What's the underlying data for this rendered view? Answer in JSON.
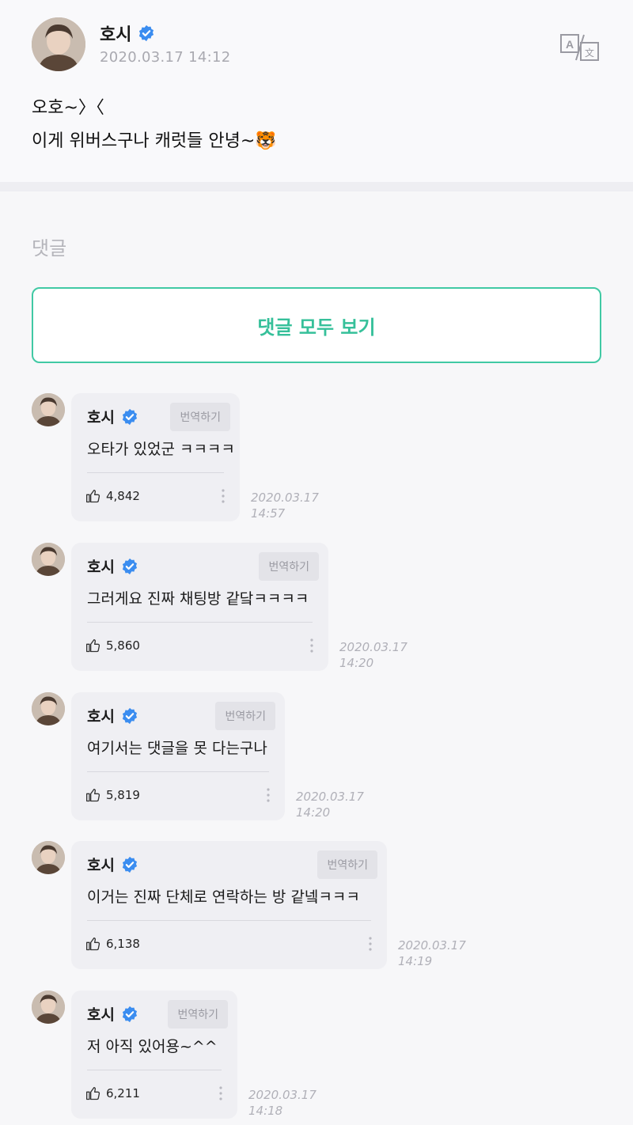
{
  "post": {
    "author": "호시",
    "timestamp": "2020.03.17 14:12",
    "lines": [
      "오호~〉〈",
      "이게 위버스구나 캐럿들 안녕~🐯"
    ],
    "translate_icon": "translate-icon"
  },
  "comments_section": {
    "label": "댓글",
    "view_all_label": "댓글 모두 보기"
  },
  "comments": [
    {
      "author": "호시",
      "translate_label": "번역하기",
      "text": "오타가 있었군 ㅋㅋㅋㅋ",
      "likes": "4,842",
      "date": "2020.03.17",
      "time": "14:57"
    },
    {
      "author": "호시",
      "translate_label": "번역하기",
      "text": "그러게요 진짜 채팅방 같닼ㅋㅋㅋㅋ",
      "likes": "5,860",
      "date": "2020.03.17",
      "time": "14:20"
    },
    {
      "author": "호시",
      "translate_label": "번역하기",
      "text": "여기서는 댓글을 못 다는구나",
      "likes": "5,819",
      "date": "2020.03.17",
      "time": "14:20"
    },
    {
      "author": "호시",
      "translate_label": "번역하기",
      "text": "이거는 진짜 단체로 연락하는 방 같넼ㅋㅋㅋ",
      "likes": "6,138",
      "date": "2020.03.17",
      "time": "14:19"
    },
    {
      "author": "호시",
      "translate_label": "번역하기",
      "text": "저 아직 있어용~^^",
      "likes": "6,211",
      "date": "2020.03.17",
      "time": "14:18"
    }
  ],
  "colors": {
    "accent": "#41c9a4",
    "verified": "#3b8df0",
    "bubble": "#efeff3"
  }
}
